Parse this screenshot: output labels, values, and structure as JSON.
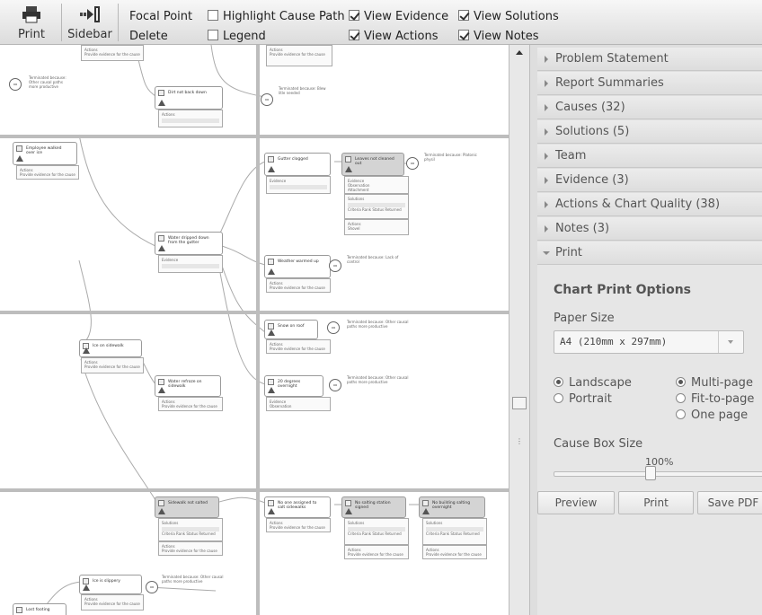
{
  "toolbar": {
    "print_label": "Print",
    "sidebar_label": "Sidebar",
    "focal_point": "Focal Point",
    "delete": "Delete",
    "highlight_cause_path": "Highlight Cause Path",
    "legend": "Legend",
    "view_evidence": "View Evidence",
    "view_actions": "View Actions",
    "view_solutions": "View Solutions",
    "view_notes": "View Notes",
    "checks": {
      "highlight_cause_path": false,
      "legend": false,
      "view_evidence": true,
      "view_actions": true,
      "view_solutions": true,
      "view_notes": true
    }
  },
  "canvas": {
    "nodes": {
      "n1": "Dirt not back down",
      "n2": "Employee walked over ice",
      "n3": "Gutter clogged",
      "n4": "Leaves not cleaned out",
      "n5": "Water dripped down from the gutter",
      "n6": "Weather warmed up",
      "n7": "Ice on sidewalk",
      "n8": "Snow on roof",
      "n9": "Water refroze on sidewalk",
      "n10": "20 degrees overnight",
      "n11": "Sidewalk not salted",
      "n12": "No one assigned to salt sidewalks",
      "n13": "No salting station signed",
      "n14": "No building salting overnight",
      "n15": "Ice is slippery",
      "n16": "Lost footing"
    },
    "sub": {
      "actions": "Actions",
      "evidence": "Evidence",
      "provide_evidence": "Provide evidence for the cause",
      "solutions": "Solutions",
      "observation": "Observation",
      "statement": "Statement",
      "attachment": "Attachment",
      "shovel": "Shovel",
      "criteria": "Criteria  Rank  Status  Returned"
    },
    "terminal": {
      "t_other": "Terminated because: Other causal paths more productive",
      "t_beyond": "Terminated because: Blew litle needed",
      "t_physics": "Terminated because: Platonic physil",
      "t_control": "Terminated because: Lack of control",
      "t_other2": "Terminated because: Other causal paths more productive",
      "t_other3": "Terminated because: Other causal paths more productive",
      "t_other4": "Terminated because: Other causal paths more productive"
    },
    "circle_label": "OR"
  },
  "panel": {
    "sections": [
      "Problem Statement",
      "Report Summaries",
      "Causes (32)",
      "Solutions (5)",
      "Team",
      "Evidence (3)",
      "Actions & Chart Quality (38)",
      "Notes (3)",
      "Print"
    ],
    "print": {
      "title": "Chart Print Options",
      "paper_size_label": "Paper Size",
      "paper_size_value": "A4 (210mm x 297mm)",
      "landscape": "Landscape",
      "portrait": "Portrait",
      "multi_page": "Multi-page",
      "fit_to_page": "Fit-to-page",
      "one_page": "One page",
      "orientation_selected": "Landscape",
      "pages_selected": "Multi-page",
      "cause_box_size_label": "Cause Box Size",
      "cause_box_size_value": "100%",
      "cause_box_size_fraction": 0.45,
      "preview_button": "Preview",
      "print_button": "Print",
      "save_pdf_button": "Save PDF"
    }
  }
}
